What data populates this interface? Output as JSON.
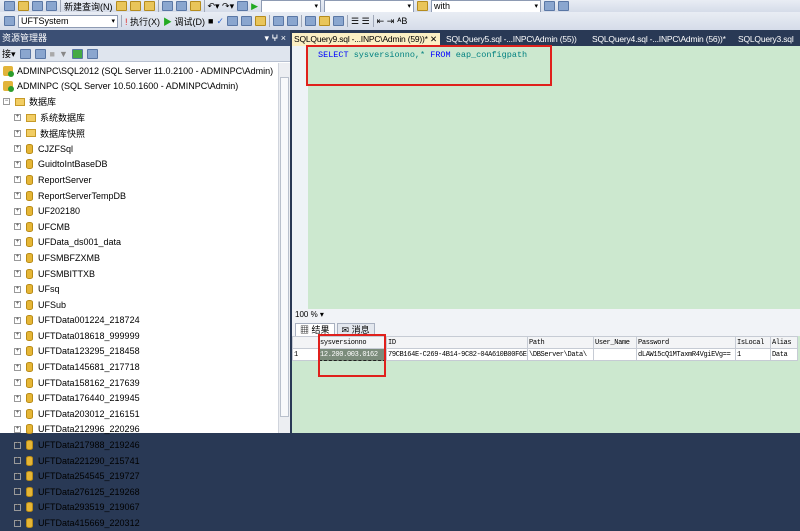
{
  "toolbar": {
    "new_query": "新建查询(N)",
    "database": "UFTSystem",
    "execute": "执行(X)",
    "debug": "调试(D)",
    "search": "with"
  },
  "explorer": {
    "title": "资源管理器",
    "connect": "连接",
    "pin": "▾ ⵖ ×",
    "servers": [
      "ADMINPC\\SQL2012 (SQL Server 11.0.2100 - ADMINPC\\Admin)",
      "ADMINPC (SQL Server 10.50.1600 - ADMINPC\\Admin)"
    ],
    "databases_folder": "数据库",
    "folders": [
      "系统数据库",
      "数据库快照"
    ],
    "databases": [
      "CJZFSql",
      "GuidtoIntBaseDB",
      "ReportServer",
      "ReportServerTempDB",
      "UF202180",
      "UFCMB",
      "UFData_ds001_data",
      "UFSMBFZXMB",
      "UFSMBITTXB",
      "UFsq",
      "UFSub",
      "UFTData001224_218724",
      "UFTData018618_999999",
      "UFTData123295_218458",
      "UFTData145681_217718",
      "UFTData158162_217639",
      "UFTData176440_219945",
      "UFTData203012_216151",
      "UFTData212996_220296",
      "UFTData217988_219246",
      "UFTData221290_215741",
      "UFTData254545_219727",
      "UFTData276125_219268",
      "UFTData293519_219067",
      "UFTData415669_220312"
    ]
  },
  "tabs": [
    "SQLQuery9.sql -...INPC\\Admin (59))*",
    "SQLQuery5.sql -...INPC\\Admin (55))",
    "SQLQuery4.sql -...INPC\\Admin (56))*",
    "SQLQuery3.sql"
  ],
  "editor": {
    "kw1": "SELECT",
    "cols": " sysversionno,* ",
    "kw2": "FROM",
    "table": " eap_configpath"
  },
  "zoom": "100 %",
  "result_tabs": [
    "结果",
    "消息"
  ],
  "grid": {
    "columns": [
      "",
      "sysversionno",
      "ID",
      "Path",
      "User_Name",
      "Password",
      "IsLocal",
      "Alias"
    ],
    "rows": [
      [
        "1",
        "12.200.003.0162",
        "79CB164E-C269-4B14-9C82-04A610B00F6E",
        "\\DBServer\\Data\\",
        "",
        "dLAW15cQ1MTaxmR4VgiEVg==",
        "1",
        "Data"
      ]
    ]
  }
}
